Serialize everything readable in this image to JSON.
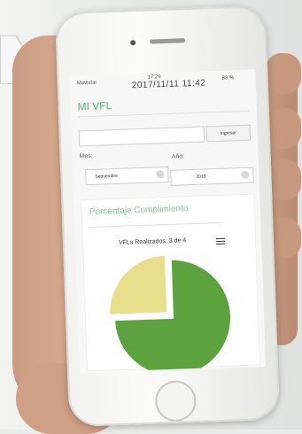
{
  "app": {
    "title": "MI VFL",
    "status_bar": {
      "carrier": "Movistar",
      "time": "17:29",
      "date_overlay": "2017/11/11 11:42",
      "battery": "83 %"
    },
    "login_button_label": "Ingresar",
    "month_label": "Mes:",
    "month_value": "Septiembre",
    "year_label": "Año:",
    "year_value": "2019",
    "section_title": "Porcentaje Cumplimiento",
    "summary": "VFLs Realizados: 3 de 4"
  },
  "chart_data": {
    "type": "pie",
    "slices": [
      {
        "value": 3,
        "color": "#5ca33f"
      },
      {
        "value": 1,
        "color": "#e8de8b"
      }
    ]
  }
}
